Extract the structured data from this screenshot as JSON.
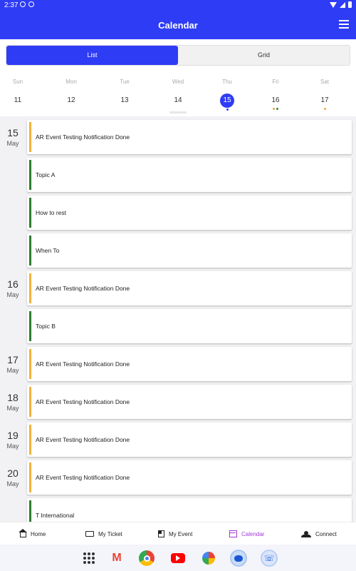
{
  "status_bar": {
    "time": "2:37"
  },
  "header": {
    "title": "Calendar"
  },
  "view_toggle": {
    "list_label": "List",
    "grid_label": "Grid",
    "selected": "List"
  },
  "week": {
    "days": [
      {
        "name": "Sun",
        "num": "11",
        "selected": false,
        "dots": []
      },
      {
        "name": "Mon",
        "num": "12",
        "selected": false,
        "dots": []
      },
      {
        "name": "Tue",
        "num": "13",
        "selected": false,
        "dots": []
      },
      {
        "name": "Wed",
        "num": "14",
        "selected": false,
        "dots": []
      },
      {
        "name": "Thu",
        "num": "15",
        "selected": true,
        "dots": [
          "#2f3cf5"
        ]
      },
      {
        "name": "Fri",
        "num": "16",
        "selected": false,
        "dots": [
          "#f0a53a",
          "#2e8b3a"
        ]
      },
      {
        "name": "Sat",
        "num": "17",
        "selected": false,
        "dots": [
          "#f0a53a"
        ]
      }
    ]
  },
  "agenda": [
    {
      "day": "15",
      "month": "May",
      "events": [
        {
          "title": "AR Event Testing Notification Done",
          "color": "#f0b33a"
        },
        {
          "title": "Topic A",
          "color": "#2e7d32"
        },
        {
          "title": "How to rest",
          "color": "#2e7d32"
        },
        {
          "title": "When To",
          "color": "#2e7d32"
        }
      ]
    },
    {
      "day": "16",
      "month": "May",
      "events": [
        {
          "title": "AR Event Testing Notification Done",
          "color": "#f0b33a"
        },
        {
          "title": "Topic B",
          "color": "#2e7d32"
        }
      ]
    },
    {
      "day": "17",
      "month": "May",
      "events": [
        {
          "title": "AR Event Testing Notification Done",
          "color": "#f0b33a"
        }
      ]
    },
    {
      "day": "18",
      "month": "May",
      "events": [
        {
          "title": "AR Event Testing Notification Done",
          "color": "#f0b33a"
        }
      ]
    },
    {
      "day": "19",
      "month": "May",
      "events": [
        {
          "title": "AR Event Testing Notification Done",
          "color": "#f0b33a"
        }
      ]
    },
    {
      "day": "20",
      "month": "May",
      "events": [
        {
          "title": "AR Event Testing Notification Done",
          "color": "#f0b33a"
        },
        {
          "title": "T International",
          "color": "#2e7d32"
        }
      ]
    }
  ],
  "bottom_nav": {
    "items": [
      {
        "label": "Home",
        "icon": "home-icon",
        "active": false
      },
      {
        "label": "My Ticket",
        "icon": "ticket-icon",
        "active": false
      },
      {
        "label": "My Event",
        "icon": "event-icon",
        "active": false
      },
      {
        "label": "Calendar",
        "icon": "calendar-icon",
        "active": true
      },
      {
        "label": "Connect",
        "icon": "people-icon",
        "active": false
      }
    ]
  },
  "dock": {
    "apps": [
      "app-drawer-icon",
      "gmail-icon",
      "chrome-icon",
      "youtube-icon",
      "photos-icon",
      "messages-icon",
      "phone-icon"
    ]
  },
  "colors": {
    "primary": "#2f3cf5",
    "active_nav": "#a23ad6",
    "event_orange": "#f0b33a",
    "event_green": "#2e7d32"
  }
}
